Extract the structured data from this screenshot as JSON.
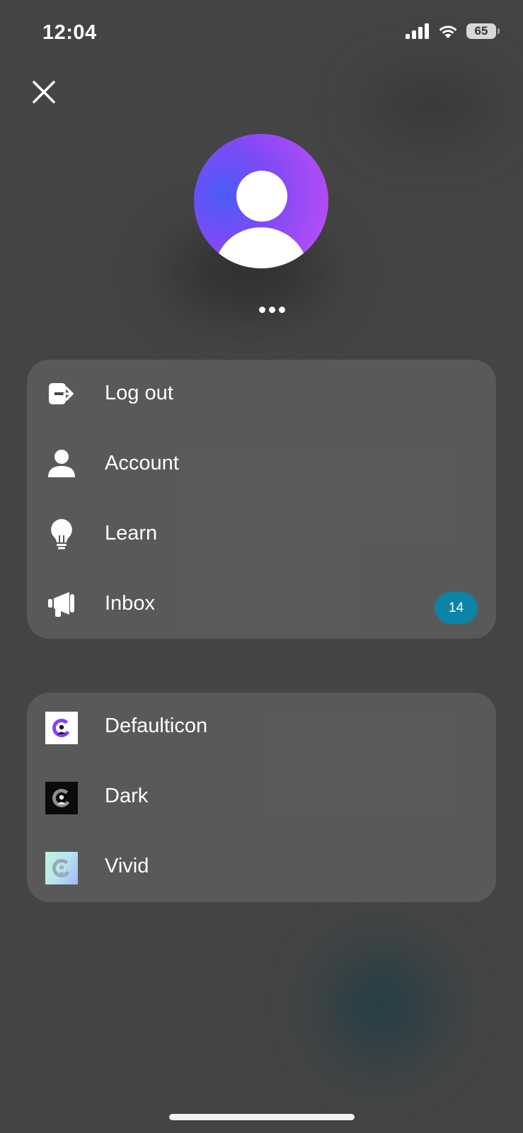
{
  "status_bar": {
    "time": "12:04",
    "battery": "65"
  },
  "menu": [
    {
      "label": "Log out",
      "icon": "log-out-icon"
    },
    {
      "label": "Account",
      "icon": "person-icon"
    },
    {
      "label": "Learn",
      "icon": "lightbulb-icon"
    },
    {
      "label": "Inbox",
      "icon": "megaphone-icon",
      "badge": "14"
    }
  ],
  "app_icons": [
    {
      "label": "Defaulticon",
      "style": "default"
    },
    {
      "label": "Dark",
      "style": "dark"
    },
    {
      "label": "Vivid",
      "style": "vivid"
    }
  ],
  "colors": {
    "badge": "#0c84a8",
    "avatar_gradient": [
      "#4a5cf7",
      "#b04cf6"
    ],
    "background": "#444444"
  }
}
